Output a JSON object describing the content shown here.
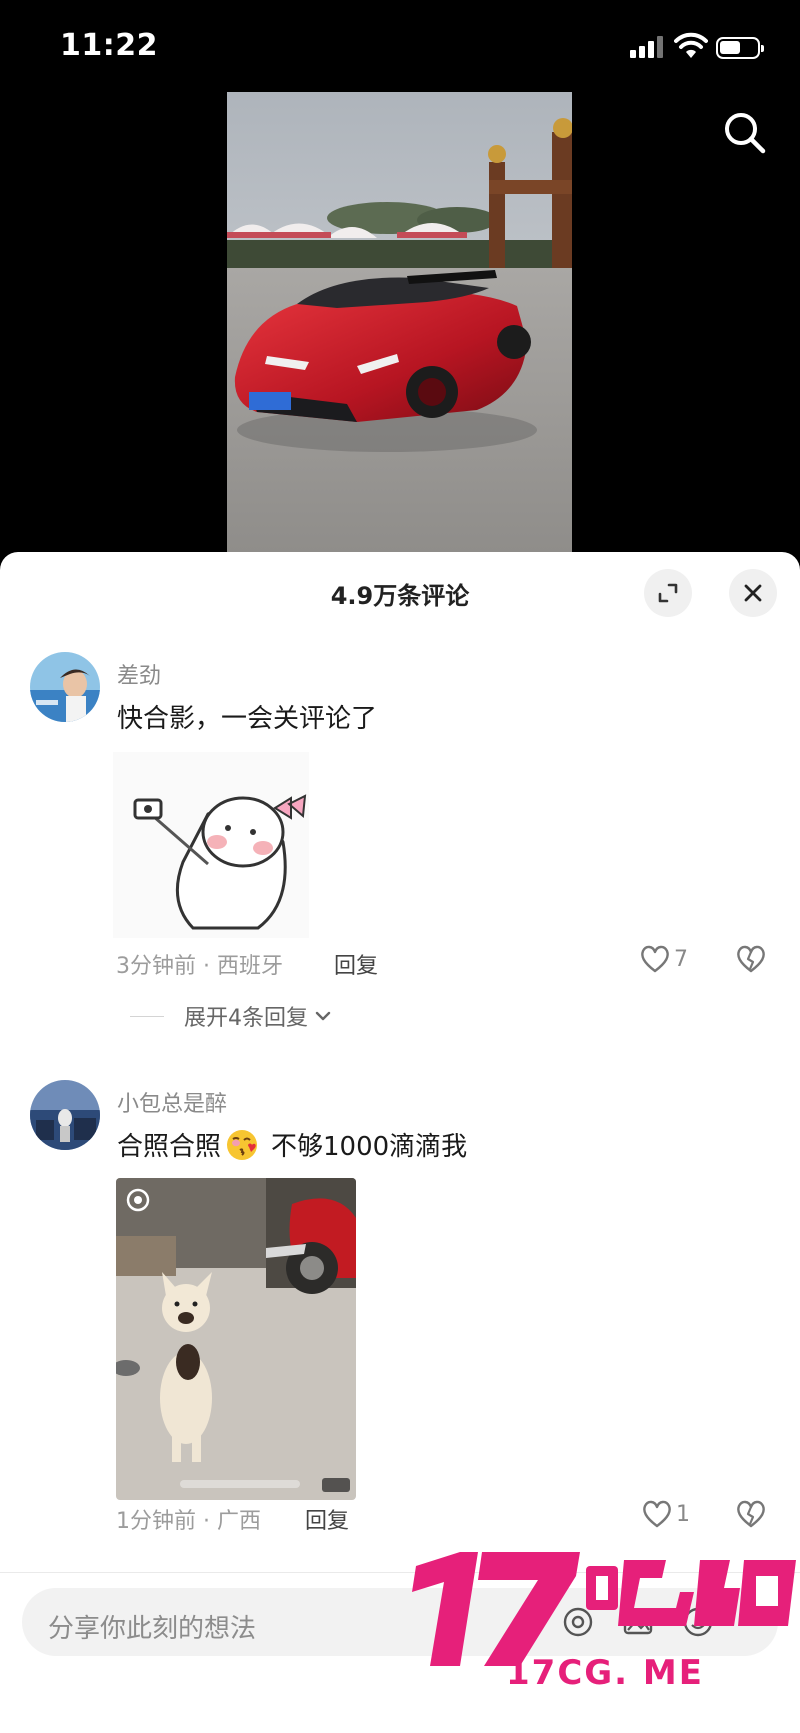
{
  "status_bar": {
    "time": "11:22"
  },
  "comments_panel": {
    "title": "4.9万条评论",
    "comments": [
      {
        "username": "差劲",
        "text": "快合影，一会关评论了",
        "meta": "3分钟前 · 西班牙",
        "reply_label": "回复",
        "like_count": "7",
        "expand_replies": "展开4条回复"
      },
      {
        "username": "小包总是醉",
        "text_before_emoji": "合照合照",
        "emoji": "kissing-face-emoji",
        "text_after_emoji": "不够1000滴滴我",
        "meta": "1分钟前 · 广西",
        "reply_label": "回复",
        "like_count": "1"
      }
    ]
  },
  "input": {
    "placeholder": "分享你此刻的想法"
  },
  "watermark": {
    "logo": "17吃瓜",
    "url": "17CG. ME"
  },
  "colors": {
    "accent": "#e6207a",
    "sheet_bg": "#ffffff",
    "text_primary": "#1a1a1a",
    "text_secondary": "#8a8a8a"
  }
}
